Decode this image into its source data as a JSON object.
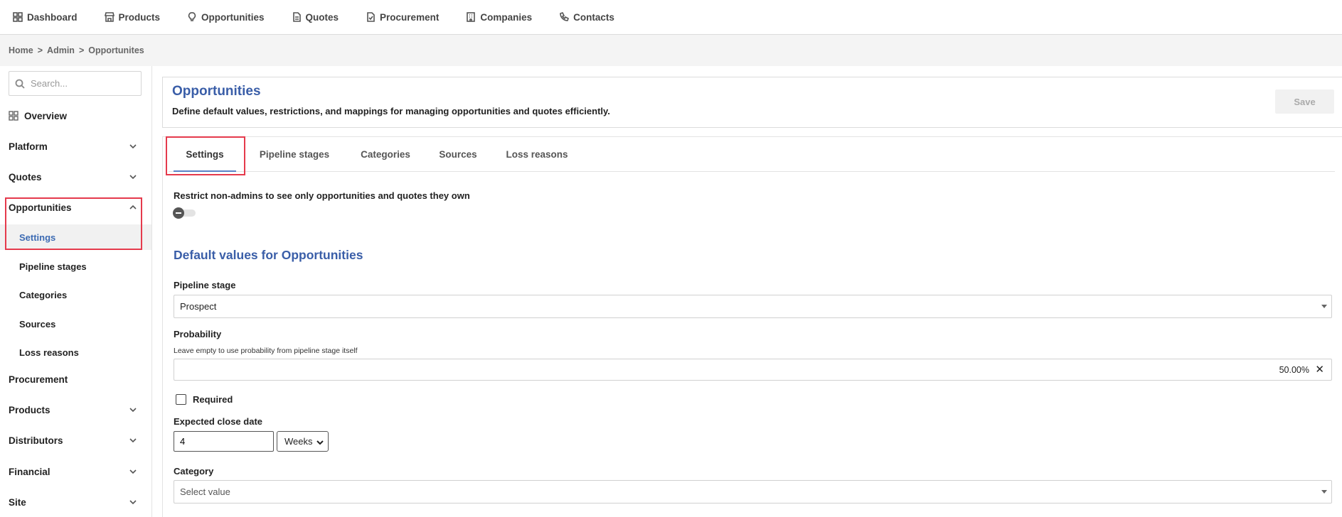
{
  "topnav": {
    "items": [
      {
        "label": "Dashboard",
        "icon": "dashboard-icon"
      },
      {
        "label": "Products",
        "icon": "store-icon"
      },
      {
        "label": "Opportunities",
        "icon": "lightbulb-icon"
      },
      {
        "label": "Quotes",
        "icon": "document-icon"
      },
      {
        "label": "Procurement",
        "icon": "document-check-icon"
      },
      {
        "label": "Companies",
        "icon": "building-icon"
      },
      {
        "label": "Contacts",
        "icon": "phone-icon"
      }
    ]
  },
  "breadcrumb": {
    "home": "Home",
    "sep": ">",
    "admin": "Admin",
    "current": "Opportunites"
  },
  "sidebar": {
    "search_placeholder": "Search...",
    "overview": "Overview",
    "sections": {
      "platform": "Platform",
      "quotes": "Quotes",
      "opportunities": "Opportunities",
      "procurement": "Procurement",
      "products": "Products",
      "distributors": "Distributors",
      "financial": "Financial",
      "site": "Site"
    },
    "opportunities_items": {
      "settings": "Settings",
      "pipeline_stages": "Pipeline stages",
      "categories": "Categories",
      "sources": "Sources",
      "loss_reasons": "Loss reasons"
    }
  },
  "header": {
    "title": "Opportunities",
    "description": "Define default values, restrictions, and mappings for managing opportunities and quotes efficiently.",
    "save_label": "Save"
  },
  "tabs": {
    "settings": "Settings",
    "pipeline_stages": "Pipeline stages",
    "categories": "Categories",
    "sources": "Sources",
    "loss_reasons": "Loss reasons"
  },
  "form": {
    "restrict_label": "Restrict non-admins to see only opportunities and quotes they own",
    "restrict_enabled": false,
    "defaults_title": "Default values for Opportunities",
    "pipeline_stage_label": "Pipeline stage",
    "pipeline_stage_value": "Prospect",
    "probability_label": "Probability",
    "probability_hint": "Leave empty to use probability from pipeline stage itself",
    "probability_value": "50.00%",
    "clear_symbol": "✕",
    "required_label": "Required",
    "required_checked": false,
    "close_date_label": "Expected close date",
    "close_date_value": "4",
    "close_date_unit": "Weeks",
    "category_label": "Category",
    "category_placeholder": "Select value"
  },
  "colors": {
    "accent": "#3a5ea8",
    "active_link": "#3d6bb3",
    "highlight": "#e53a4c",
    "tab_underline": "#5a82c7"
  }
}
